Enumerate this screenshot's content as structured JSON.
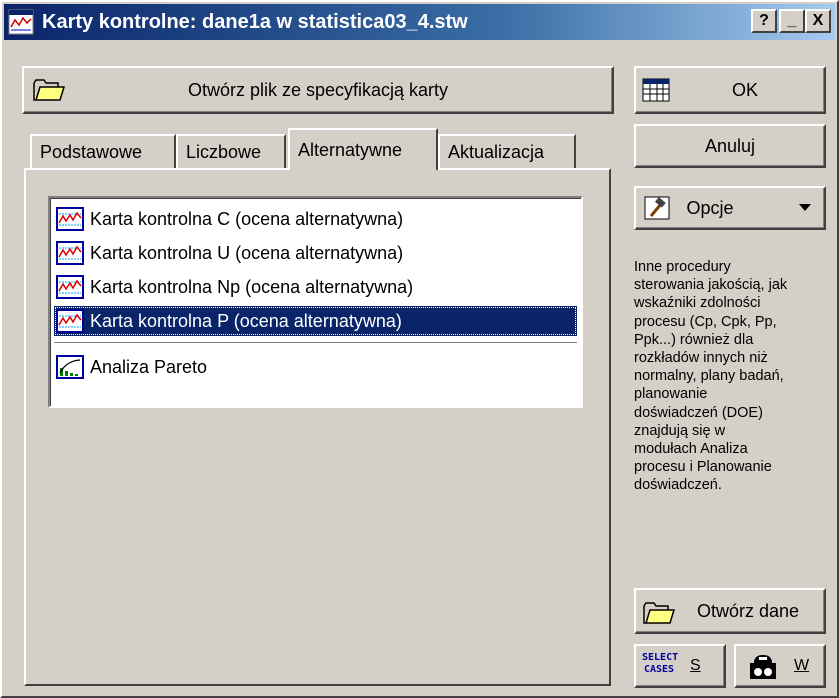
{
  "window": {
    "title": "Karty kontrolne: dane1a w statistica03_4.stw",
    "controls": {
      "help": "?",
      "minimize": "_",
      "close": "X"
    }
  },
  "open_spec_button": {
    "label": "Otwórz plik ze specyfikacją karty",
    "icon": "open-folder-icon"
  },
  "tabs": [
    {
      "label": "Podstawowe",
      "active": false
    },
    {
      "label": "Liczbowe",
      "active": false
    },
    {
      "label": "Alternatywne",
      "active": true
    },
    {
      "label": "Aktualizacja",
      "active": false
    }
  ],
  "chart_list": {
    "items": [
      {
        "label": "Karta kontrolna C (ocena alternatywna)",
        "icon": "control-chart-icon",
        "selected": false
      },
      {
        "label": "Karta kontrolna U (ocena alternatywna)",
        "icon": "control-chart-icon",
        "selected": false
      },
      {
        "label": "Karta kontrolna Np (ocena alternatywna)",
        "icon": "control-chart-icon",
        "selected": false
      },
      {
        "label": "Karta kontrolna P (ocena alternatywna)",
        "icon": "control-chart-icon",
        "selected": true
      },
      {
        "label": "Analiza Pareto",
        "icon": "pareto-chart-icon",
        "selected": false
      }
    ]
  },
  "side": {
    "ok_label": "OK",
    "cancel_label": "Anuluj",
    "options_label": "Opcje",
    "info_lines": [
      "Inne procedury",
      "sterowania jakością, jak",
      "wskaźniki zdolności",
      "procesu (Cp, Cpk, Pp,",
      "Ppk...) również dla",
      "rozkładów innych niż",
      "normalny, plany badań,",
      "planowanie",
      "doświadczeń (DOE)",
      "znajdują się w",
      "modułach Analiza",
      "procesu i Planowanie",
      "doświadczeń."
    ],
    "open_data_label": "Otwórz dane",
    "select_cases_icon_text": [
      "SELECT",
      "CASES"
    ],
    "select_cases_label": "S",
    "weights_label": "W"
  },
  "colors": {
    "title_active": "#0a246a",
    "face": "#d4d0c8",
    "selection": "#0a246a"
  }
}
